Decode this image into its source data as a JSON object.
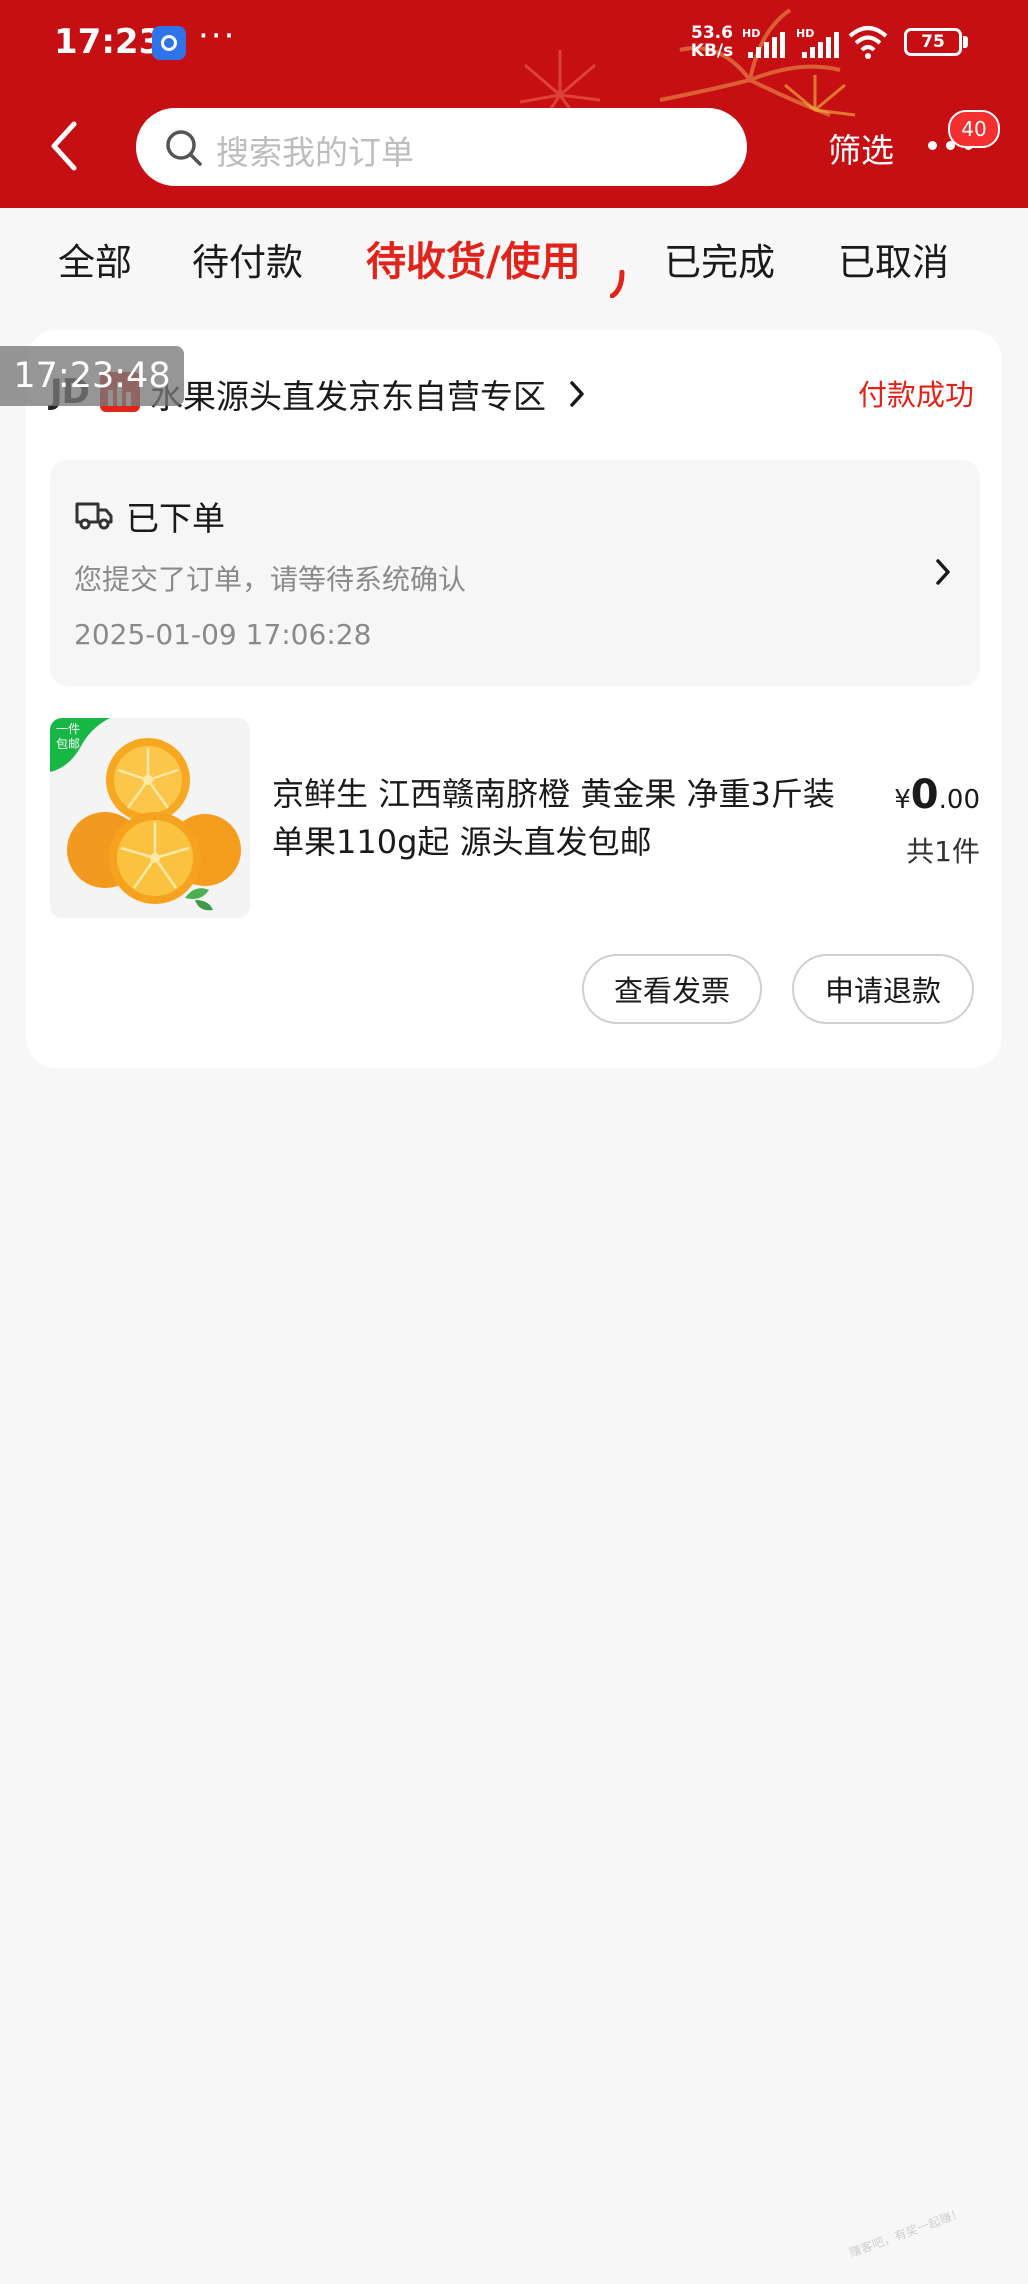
{
  "status_bar": {
    "time": "17:23",
    "more": "···",
    "net_speed_value": "53.6",
    "net_speed_unit": "KB/s",
    "signal_1_label": "HD",
    "signal_2_label": "HD",
    "battery": "75"
  },
  "header": {
    "search_placeholder": "搜索我的订单",
    "filter_label": "筛选",
    "badge_count": "40"
  },
  "tabs": [
    {
      "label": "全部"
    },
    {
      "label": "待付款"
    },
    {
      "label": "待收货/使用",
      "active": true
    },
    {
      "label": "已完成"
    },
    {
      "label": "已取消"
    }
  ],
  "screenshot_timestamp": "17:23:48",
  "order": {
    "shop_prefix": "JD",
    "shop_name": "水果源头直发京东自营专区",
    "status": "付款成功",
    "progress": {
      "title": "已下单",
      "description": "您提交了订单，请等待系统确认",
      "time": "2025-01-09 17:06:28"
    },
    "product": {
      "tag_line1": "一件",
      "tag_line2": "包邮",
      "title": "京鲜生 江西赣南脐橙 黄金果 净重3斤装 单果110g起 源头直发包邮",
      "currency": "¥",
      "price_int": "0",
      "price_dec": ".00",
      "quantity": "共1件"
    },
    "buttons": {
      "invoice": "查看发票",
      "refund": "申请退款"
    }
  },
  "watermark": "赚客吧，有奖一起赚！",
  "colors": {
    "header_red": "#c60f13",
    "accent_red": "#e2231a",
    "badge_red": "#f32f2f",
    "tag_green": "#16b843"
  }
}
